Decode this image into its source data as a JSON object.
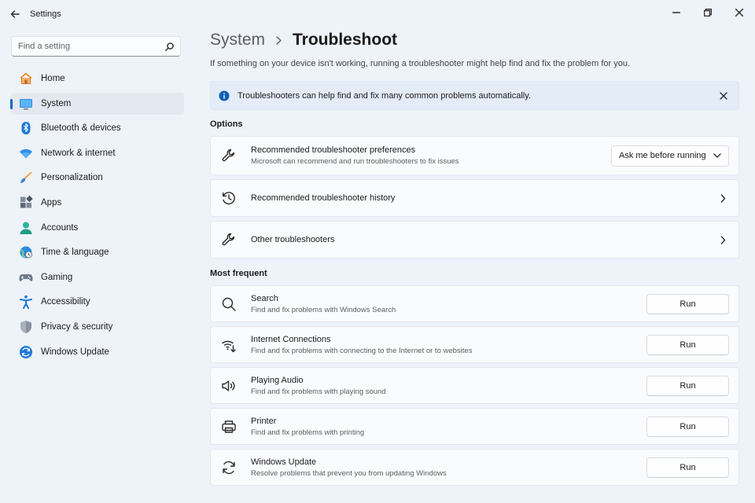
{
  "window": {
    "title": "Settings"
  },
  "search": {
    "placeholder": "Find a setting"
  },
  "sidebar": {
    "items": [
      {
        "label": "Home",
        "icon": "home-icon",
        "active": false
      },
      {
        "label": "System",
        "icon": "system-icon",
        "active": true
      },
      {
        "label": "Bluetooth & devices",
        "icon": "bluetooth-icon",
        "active": false
      },
      {
        "label": "Network & internet",
        "icon": "wifi-icon",
        "active": false
      },
      {
        "label": "Personalization",
        "icon": "brush-icon",
        "active": false
      },
      {
        "label": "Apps",
        "icon": "apps-icon",
        "active": false
      },
      {
        "label": "Accounts",
        "icon": "accounts-icon",
        "active": false
      },
      {
        "label": "Time & language",
        "icon": "globe-clock-icon",
        "active": false
      },
      {
        "label": "Gaming",
        "icon": "gamepad-icon",
        "active": false
      },
      {
        "label": "Accessibility",
        "icon": "accessibility-icon",
        "active": false
      },
      {
        "label": "Privacy & security",
        "icon": "shield-icon",
        "active": false
      },
      {
        "label": "Windows Update",
        "icon": "update-icon",
        "active": false
      }
    ]
  },
  "header": {
    "parent": "System",
    "separator": "›",
    "current": "Troubleshoot",
    "description": "If something on your device isn't working, running a troubleshooter might help find and fix the problem for you."
  },
  "info_bar": {
    "text": "Troubleshooters can help find and fix many common problems automatically."
  },
  "options": {
    "title": "Options",
    "preferences": {
      "title": "Recommended troubleshooter preferences",
      "subtitle": "Microsoft can recommend and run troubleshooters to fix issues",
      "dropdown_value": "Ask me before running"
    },
    "history": {
      "title": "Recommended troubleshooter history"
    },
    "other": {
      "title": "Other troubleshooters"
    }
  },
  "most_frequent": {
    "title": "Most frequent",
    "run_label": "Run",
    "items": [
      {
        "title": "Search",
        "subtitle": "Find and fix problems with Windows Search",
        "icon": "search-icon"
      },
      {
        "title": "Internet Connections",
        "subtitle": "Find and fix problems with connecting to the Internet or to websites",
        "icon": "internet-icon"
      },
      {
        "title": "Playing Audio",
        "subtitle": "Find and fix problems with playing sound",
        "icon": "speaker-icon"
      },
      {
        "title": "Printer",
        "subtitle": "Find and fix problems with printing",
        "icon": "printer-icon"
      },
      {
        "title": "Windows Update",
        "subtitle": "Resolve problems that prevent you from updating Windows",
        "icon": "sync-icon"
      }
    ]
  },
  "colors": {
    "accent": "#0067c0",
    "background": "#eef2f9",
    "card": "#fafbfd",
    "info": "#e4ecf7"
  }
}
